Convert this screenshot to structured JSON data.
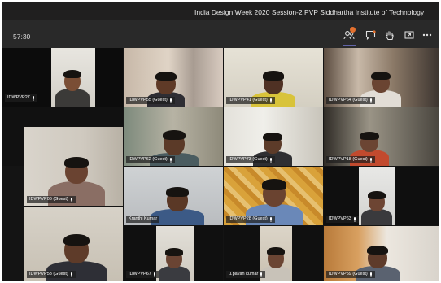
{
  "window": {
    "title": "India Design Week 2020 Session-2 PVP Siddhartha Institute of Technology"
  },
  "toolbar": {
    "timer": "57:30",
    "chat_badge": "",
    "buttons": [
      {
        "icon": "participants-icon"
      },
      {
        "icon": "chat-icon"
      },
      {
        "icon": "raise-hand-icon"
      },
      {
        "icon": "share-screen-icon"
      },
      {
        "icon": "more-options-icon"
      }
    ]
  },
  "colors": {
    "accent": "#6264a7",
    "background": "#292929",
    "badge": "#e3702e"
  },
  "participants": [
    {
      "name": "IDWPVP27",
      "mic": true
    },
    {
      "name": "IDWPVP55 (Guest)",
      "mic": true
    },
    {
      "name": "IDWPVP41 (Guest)",
      "mic": true
    },
    {
      "name": "IDWPVP64 (Guest)",
      "mic": true
    },
    {
      "name": "IDWPVP06 (Guest)",
      "mic": true
    },
    {
      "name": "IDWPVP62 (Guest)",
      "mic": true
    },
    {
      "name": "IDWPVP73 (Guest)",
      "mic": true
    },
    {
      "name": "IDWPVP18 (Guest)",
      "mic": true
    },
    {
      "name": "Kranthi Kumar",
      "mic": false
    },
    {
      "name": "IDWPVP28 (Guest)",
      "mic": true
    },
    {
      "name": "IDWPVP63",
      "mic": true
    },
    {
      "name": "IDWPVP53 (Guest)",
      "mic": true
    },
    {
      "name": "IDWPVP67",
      "mic": true
    },
    {
      "name": "u.pavan kumar",
      "mic": true
    },
    {
      "name": "IDWPVP59 (Guest)",
      "mic": true
    }
  ]
}
